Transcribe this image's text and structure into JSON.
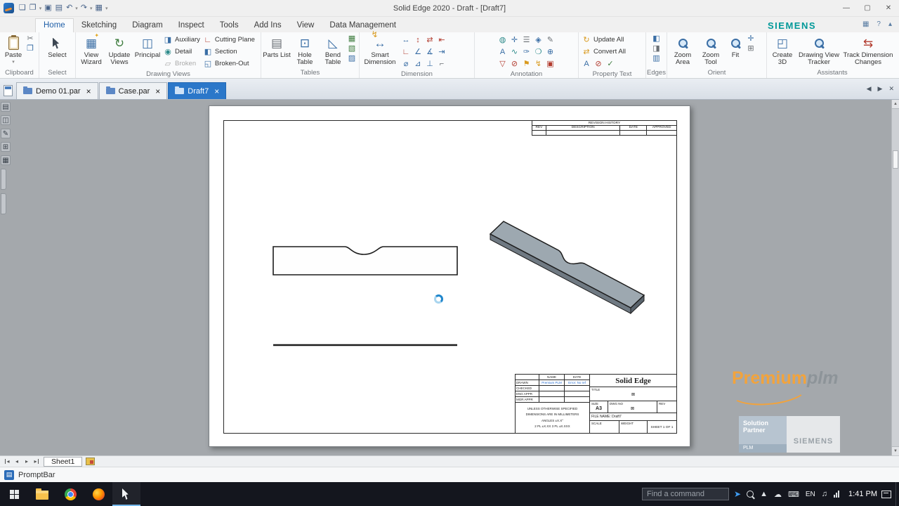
{
  "titlebar": {
    "title": "Solid Edge 2020 - Draft - [Draft7]"
  },
  "tabrow": {
    "items": [
      "Home",
      "Sketching",
      "Diagram",
      "Inspect",
      "Tools",
      "Add Ins",
      "View",
      "Data Management"
    ],
    "siemens": "SIEMENS"
  },
  "ribbon": {
    "paste": "Paste",
    "clipboard": "Clipboard",
    "select_btn": "Select",
    "select_group": "Select",
    "view_wizard": "View Wizard",
    "update_views": "Update Views",
    "principal": "Principal",
    "auxiliary": "Auxiliary",
    "detail": "Detail",
    "broken": "Broken",
    "cutting_plane": "Cutting Plane",
    "section": "Section",
    "broken_out": "Broken-Out",
    "drawing_views": "Drawing Views",
    "parts_list": "Parts List",
    "hole_table": "Hole Table",
    "bend_table": "Bend Table",
    "tables": "Tables",
    "smart_dimension": "Smart Dimension",
    "dimension": "Dimension",
    "annotation": "Annotation",
    "update_all": "Update All",
    "convert_all": "Convert All",
    "property_text": "Property Text",
    "edges": "Edges",
    "zoom_area": "Zoom Area",
    "zoom_tool": "Zoom Tool",
    "fit": "Fit",
    "orient": "Orient",
    "create_3d": "Create 3D",
    "view_tracker": "Drawing View Tracker",
    "track_changes": "Track Dimension Changes",
    "assistants": "Assistants"
  },
  "doctabs": {
    "t1": "Demo 01.par",
    "t2": "Case.par",
    "t3": "Draft7"
  },
  "sheet": {
    "rev_title": "REVISION HISTORY",
    "rev_col1": "REV",
    "rev_col2": "DESCRIPTION",
    "rev_col3": "DATE",
    "rev_col4": "APPROVED",
    "tb": {
      "name": "NAME",
      "date": "DATE",
      "drawn": "DRAWN",
      "drawn_name": "Premium PLM",
      "drawn_date": "Error: No ref",
      "checked": "CHECKED",
      "eng": "ENG APPR",
      "mgr": "MGR APPR",
      "n1": "UNLESS OTHERWISE SPECIFIED",
      "n2": "DIMENSIONS ARE IN MILLIMETERS",
      "n3": "ANGLES ±X.X°",
      "n4": "2 PL ±X.XX 3 PL ±X.XXX",
      "company": "Solid Edge",
      "title": "TITLE",
      "size": "SIZE",
      "size_v": "A3",
      "dwg": "DWG NO",
      "rev": "REV",
      "file": "FILE NAME: Draft7",
      "scale": "SCALE",
      "weight": "WEIGHT",
      "sheet": "SHEET 1 OF 1"
    }
  },
  "watermark": {
    "premium": "Premium",
    "plm": "plm",
    "sol1": "Solution",
    "sol2": "Partner",
    "siemens": "SIEMENS",
    "plmbar": "PLM"
  },
  "bottom": {
    "sheet1": "Sheet1",
    "promptbar": "PromptBar"
  },
  "taskbar": {
    "find": "Find a command",
    "lang": "EN",
    "time": "1:41 PM"
  },
  "icons": {
    "dropdown": "▾",
    "qat": [
      "❏",
      "❐",
      "▣",
      "▤",
      "↶",
      "↷",
      "▦"
    ],
    "win_min": "—",
    "win_max": "▢",
    "win_close": "✕",
    "help": "?",
    "style": "▦",
    "pin": "▴",
    "tab_close": "×",
    "arrow_left": "◀",
    "arrow_right": "▶",
    "cut": "✂",
    "copy": "❐",
    "view_wizard": "▦",
    "wizard_spark": "✦",
    "update_views": "↻",
    "principal": "◫",
    "auxiliary": "◨",
    "detail": "◉",
    "broken": "▱",
    "cutting_plane": "∟",
    "section": "◧",
    "broken_out": "◱",
    "parts_list": "▤",
    "hole_table": "⊡",
    "bend_table": "◺",
    "tables_small": [
      "▦",
      "▧",
      "▨"
    ],
    "smart_bolt": "↯",
    "smart_arrow": "↔",
    "dim_icons": [
      "↔",
      "∟",
      "⌀",
      "↕",
      "∠",
      "⊿",
      "⇄",
      "∡",
      "⊥",
      "⇤",
      "⇥",
      "⌐"
    ],
    "ann_icons": [
      "◍",
      "A",
      "▽",
      "✛",
      "∿",
      "⊘",
      "☰",
      "✑",
      "⚑",
      "◈",
      "❍",
      "↯",
      "✎",
      "⊕",
      "▣"
    ],
    "update_all": "↻",
    "convert_all": "⇄",
    "prop_icons": [
      "A",
      "⊘",
      "✓"
    ],
    "edge_icons": [
      "◧",
      "◨",
      "▥"
    ],
    "orient_small": [
      "✛",
      "⊞"
    ],
    "create_3d": "◰",
    "track_changes": "⇆",
    "nav_first": "◂",
    "nav_prev": "◂",
    "nav_next": "▸",
    "nav_last": "▸",
    "promptbar_icon": "▤",
    "tray_caret": "▲",
    "tray_cloud": "☁",
    "tray_kbd": "⌨",
    "tray_note": "♫",
    "send": "➤",
    "scroll_up": "▲",
    "scroll_down": "▼",
    "dock": [
      "▤",
      "◫",
      "✎",
      "⊞",
      "▦"
    ],
    "placeholder_mark": "⊠"
  }
}
